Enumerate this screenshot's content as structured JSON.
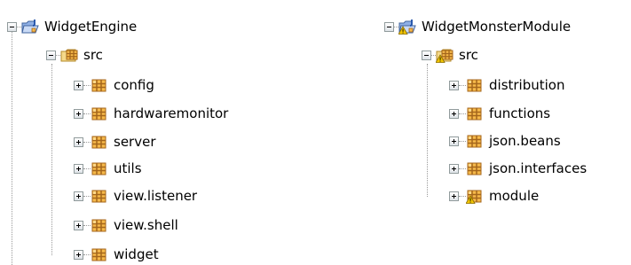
{
  "left_tree": {
    "project": {
      "label": "WidgetEngine",
      "icon": "java-project-icon",
      "expanded": true
    },
    "source_folder": {
      "label": "src",
      "icon": "source-folder-icon",
      "expanded": true
    },
    "packages": [
      {
        "label": "config",
        "icon": "package-icon"
      },
      {
        "label": "hardwaremonitor",
        "icon": "package-icon"
      },
      {
        "label": "server",
        "icon": "package-icon"
      },
      {
        "label": "utils",
        "icon": "package-icon"
      },
      {
        "label": "view.listener",
        "icon": "package-icon"
      },
      {
        "label": "view.shell",
        "icon": "package-icon"
      },
      {
        "label": "widget",
        "icon": "package-icon"
      }
    ]
  },
  "right_tree": {
    "project": {
      "label": "WidgetMonsterModule",
      "icon": "java-project-warning-icon",
      "expanded": true
    },
    "source_folder": {
      "label": "src",
      "icon": "source-folder-warning-icon",
      "expanded": true
    },
    "packages": [
      {
        "label": "distribution",
        "icon": "package-icon"
      },
      {
        "label": "functions",
        "icon": "package-icon"
      },
      {
        "label": "json.beans",
        "icon": "package-icon"
      },
      {
        "label": "json.interfaces",
        "icon": "package-icon"
      },
      {
        "label": "module",
        "icon": "package-warning-icon"
      }
    ]
  },
  "colors": {
    "connector": "#9a9a9a",
    "package_orange": "#f0a030",
    "package_brown": "#8a5a1a",
    "folder_blue": "#6a8fd0",
    "warning_yellow": "#f2c500"
  }
}
